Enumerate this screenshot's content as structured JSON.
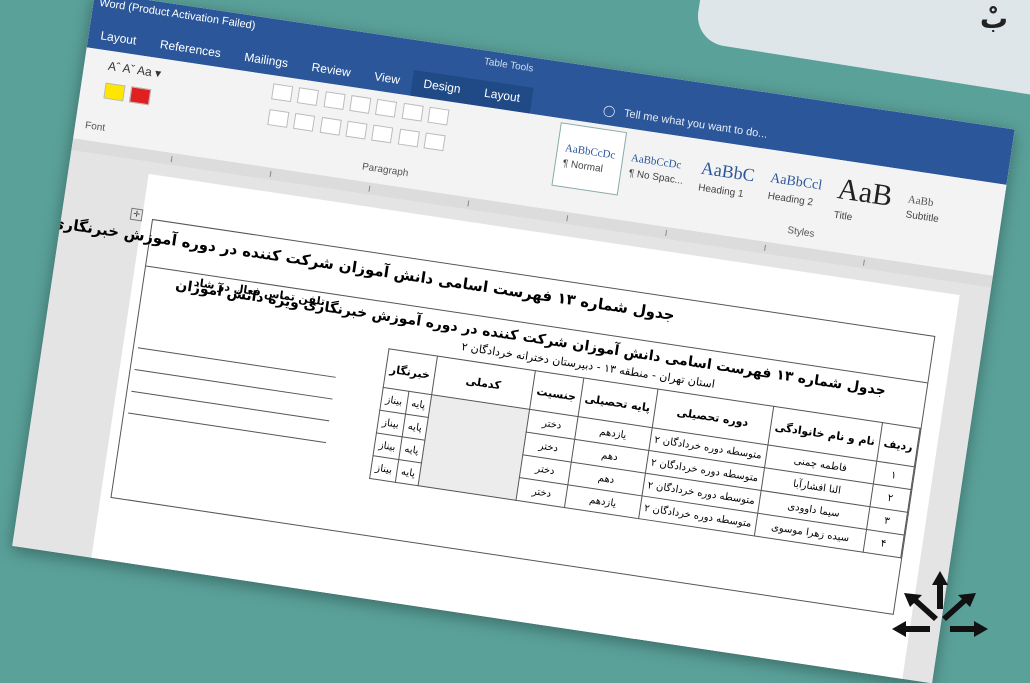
{
  "window": {
    "title": "Word (Product Activation Failed)",
    "tools_label": "Table Tools"
  },
  "tabs": [
    "Layout",
    "References",
    "Mailings",
    "Review",
    "View",
    "Design",
    "Layout"
  ],
  "tell_me": "Tell me what you want to do...",
  "ribbon": {
    "font_group_label": "Font",
    "paragraph_group_label": "Paragraph",
    "styles_group_label": "Styles",
    "font_size_ctrl": "Aˆ Aˇ  Aa ▾",
    "styles": [
      {
        "sample": "AaBbCcDc",
        "name": "¶ Normal",
        "size": 11,
        "selected": true
      },
      {
        "sample": "AaBbCcDc",
        "name": "¶ No Spac...",
        "size": 11,
        "selected": false
      },
      {
        "sample": "AaBbC",
        "name": "Heading 1",
        "size": 18,
        "selected": false
      },
      {
        "sample": "AaBbCcl",
        "name": "Heading 2",
        "size": 14,
        "selected": false
      },
      {
        "sample": "AaB",
        "name": "Title",
        "size": 30,
        "selected": false
      },
      {
        "sample": "AaBb",
        "name": "Subtitle",
        "size": 11,
        "selected": false
      }
    ]
  },
  "document": {
    "heading": "جدول شماره ۱۳ فهرست اسامی دانش آموزان شرکت کننده در دوره آموزش خبرنگاری ویژه دانش آموزان",
    "table_caption": "جدول شماره ۱۳ فهرست اسامی دانش آموزان شرکت کننده در دوره آموزش خبرنگاری ویژه دانش آموزان",
    "table_sub": "استان تهران - منطقه ۱۳ - دبیرستان دخترانه خردادگان ۲",
    "sign_header": "تلفن تماس فعال در شاد",
    "columns": [
      "ردیف",
      "نام و نام خانوادگی",
      "دوره تحصیلی",
      "پایه تحصیلی",
      "جنسیت",
      "کدملی",
      "خبرنگار"
    ],
    "rows": [
      {
        "n": "۱",
        "name": "فاطمه چمنی",
        "course": "متوسطه دوره خردادگان ۲",
        "grade": "یازدهم",
        "gender": "دختر",
        "r1": "پایه",
        "r2": "بیناز"
      },
      {
        "n": "۲",
        "name": "النا افشارآبا",
        "course": "متوسطه دوره خردادگان ۲",
        "grade": "دهم",
        "gender": "دختر",
        "r1": "پایه",
        "r2": "بیناز"
      },
      {
        "n": "۳",
        "name": "سیما داوودی",
        "course": "متوسطه دوره خردادگان ۲",
        "grade": "دهم",
        "gender": "دختر",
        "r1": "پایه",
        "r2": "بیناز"
      },
      {
        "n": "۴",
        "name": "سیده زهرا موسوی",
        "course": "متوسطه دوره خردادگان ۲",
        "grade": "یازدهم",
        "gender": "دختر",
        "r1": "پایه",
        "r2": "بیناز"
      }
    ]
  }
}
